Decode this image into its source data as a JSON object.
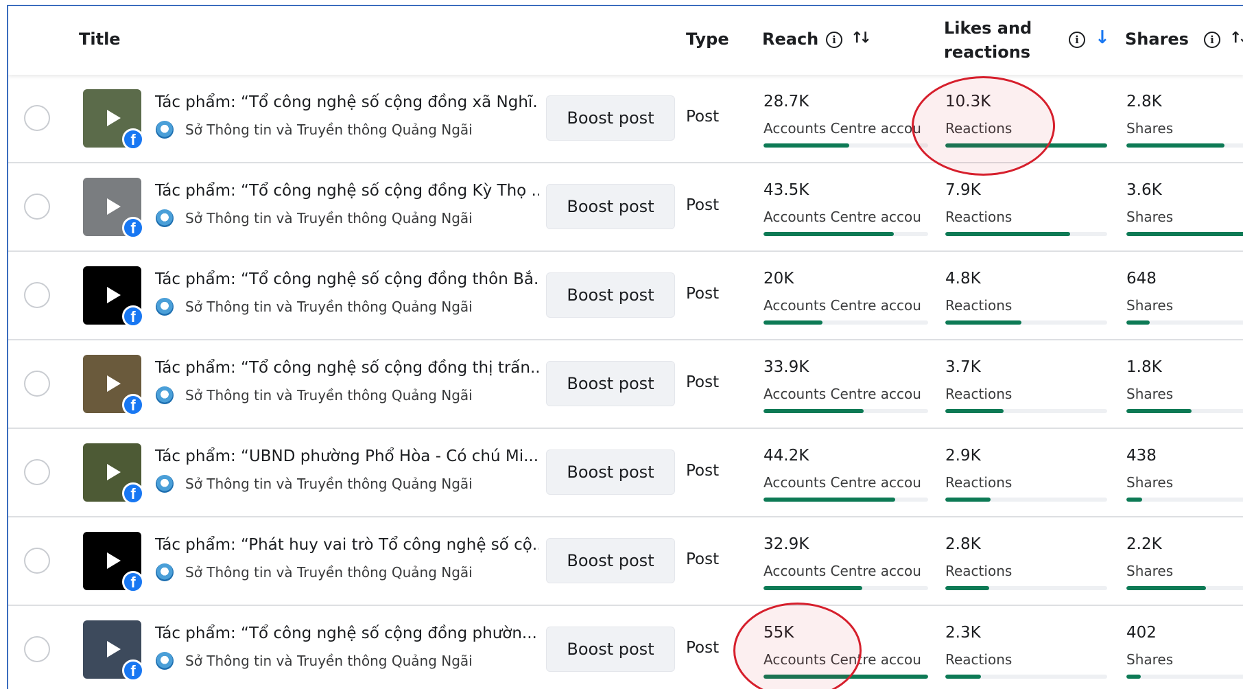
{
  "header": {
    "title": "Title",
    "type": "Type",
    "reach": "Reach",
    "likes": "Likes and reactions",
    "shares": "Shares",
    "info_glyph": "i",
    "sort_glyph": "↑↓",
    "sort_desc_glyph": "↓"
  },
  "boost_label": "Boost post",
  "facebook_glyph": "f",
  "rows": [
    {
      "title": "Tác phẩm: “Tổ công nghệ số cộng đồng xã Nghĩ...",
      "page": "Sở Thông tin và Truyền thông Quảng Ngãi",
      "type": "Post",
      "reach": "28.7K",
      "reach_label": "Accounts Centre accou...",
      "reach_fill": 0.52,
      "likes": "10.3K",
      "likes_label": "Reactions",
      "likes_fill": 1.0,
      "shares": "2.8K",
      "shares_label": "Shares",
      "shares_fill": 0.75,
      "thumb_color": "#5b6b4a"
    },
    {
      "title": "Tác phẩm: “Tổ công nghệ số cộng đồng Kỳ Thọ ...",
      "page": "Sở Thông tin và Truyền thông Quảng Ngãi",
      "type": "Post",
      "reach": "43.5K",
      "reach_label": "Accounts Centre accou...",
      "reach_fill": 0.79,
      "likes": "7.9K",
      "likes_label": "Reactions",
      "likes_fill": 0.77,
      "shares": "3.6K",
      "shares_label": "Shares",
      "shares_fill": 0.98,
      "thumb_color": "#7a7d80"
    },
    {
      "title": "Tác phẩm: “Tổ công nghệ số cộng đồng thôn Bắ...",
      "page": "Sở Thông tin và Truyền thông Quảng Ngãi",
      "type": "Post",
      "reach": "20K",
      "reach_label": "Accounts Centre accou...",
      "reach_fill": 0.36,
      "likes": "4.8K",
      "likes_label": "Reactions",
      "likes_fill": 0.47,
      "shares": "648",
      "shares_label": "Shares",
      "shares_fill": 0.18,
      "thumb_color": "#000000"
    },
    {
      "title": "Tác phẩm: “Tổ công nghệ số cộng đồng thị trấn...",
      "page": "Sở Thông tin và Truyền thông Quảng Ngãi",
      "type": "Post",
      "reach": "33.9K",
      "reach_label": "Accounts Centre accou...",
      "reach_fill": 0.61,
      "likes": "3.7K",
      "likes_label": "Reactions",
      "likes_fill": 0.36,
      "shares": "1.8K",
      "shares_label": "Shares",
      "shares_fill": 0.5,
      "thumb_color": "#6a5a3c"
    },
    {
      "title": "Tác phẩm: “UBND phường Phổ Hòa - Có chú Mi...",
      "page": "Sở Thông tin và Truyền thông Quảng Ngãi",
      "type": "Post",
      "reach": "44.2K",
      "reach_label": "Accounts Centre accou...",
      "reach_fill": 0.8,
      "likes": "2.9K",
      "likes_label": "Reactions",
      "likes_fill": 0.28,
      "shares": "438",
      "shares_label": "Shares",
      "shares_fill": 0.12,
      "thumb_color": "#4d5a35"
    },
    {
      "title": "Tác phẩm: “Phát huy vai trò Tổ công nghệ số cộ...",
      "page": "Sở Thông tin và Truyền thông Quảng Ngãi",
      "type": "Post",
      "reach": "32.9K",
      "reach_label": "Accounts Centre accou...",
      "reach_fill": 0.6,
      "likes": "2.8K",
      "likes_label": "Reactions",
      "likes_fill": 0.27,
      "shares": "2.2K",
      "shares_label": "Shares",
      "shares_fill": 0.61,
      "thumb_color": "#000000"
    },
    {
      "title": "Tác phẩm: “Tổ công nghệ số cộng đồng phườn...",
      "page": "Sở Thông tin và Truyền thông Quảng Ngãi",
      "type": "Post",
      "reach": "55K",
      "reach_label": "Accounts Centre accou...",
      "reach_fill": 1.0,
      "likes": "2.3K",
      "likes_label": "Reactions",
      "likes_fill": 0.22,
      "shares": "402",
      "shares_label": "Shares",
      "shares_fill": 0.11,
      "thumb_color": "#3d4a5c"
    }
  ],
  "colors": {
    "bar": "#0d7a55",
    "annotation": "#d61f2c",
    "accent": "#1877f2"
  }
}
